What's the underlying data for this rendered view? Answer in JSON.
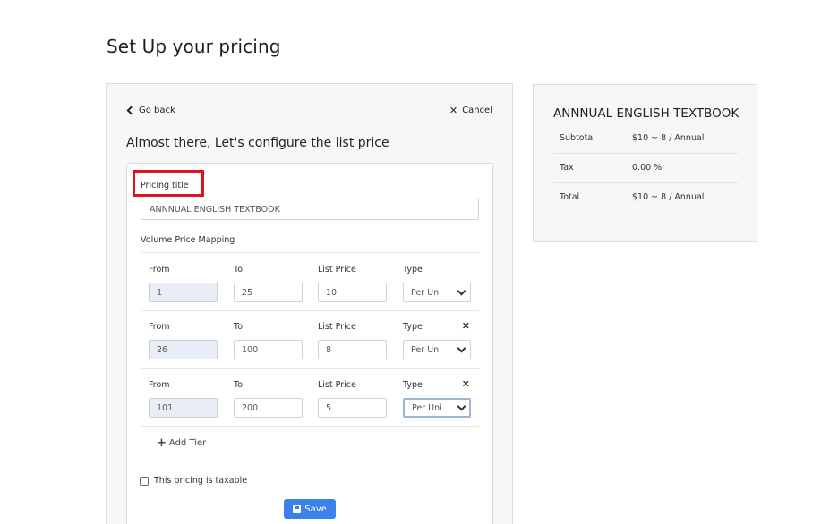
{
  "page": {
    "title": "Set Up your pricing"
  },
  "nav": {
    "go_back": "Go back",
    "cancel": "Cancel"
  },
  "form": {
    "subheading": "Almost there, Let's configure the list price",
    "pricing_title_label": "Pricing title",
    "pricing_title_value": "ANNNUAL ENGLISH TEXTBOOK",
    "volume_label": "Volume Price Mapping",
    "columns": {
      "from": "From",
      "to": "To",
      "list_price": "List Price",
      "type": "Type"
    },
    "tiers": [
      {
        "from": "1",
        "to": "25",
        "list_price": "10",
        "type": "Per Uni"
      },
      {
        "from": "26",
        "to": "100",
        "list_price": "8",
        "type": "Per Uni"
      },
      {
        "from": "101",
        "to": "200",
        "list_price": "5",
        "type": "Per Uni"
      }
    ],
    "add_tier": "Add Tier",
    "taxable_label": "This pricing is taxable",
    "save_label": "Save"
  },
  "summary": {
    "title": "ANNNUAL ENGLISH TEXTBOOK",
    "rows": [
      {
        "label": "Subtotal",
        "value": "$10 ~ 8 / Annual"
      },
      {
        "label": "Tax",
        "value": "0.00 %"
      },
      {
        "label": "Total",
        "value": "$10 ~ 8 / Annual"
      }
    ]
  },
  "colors": {
    "accent": "#3a82ea",
    "highlight": "#d9141e"
  }
}
